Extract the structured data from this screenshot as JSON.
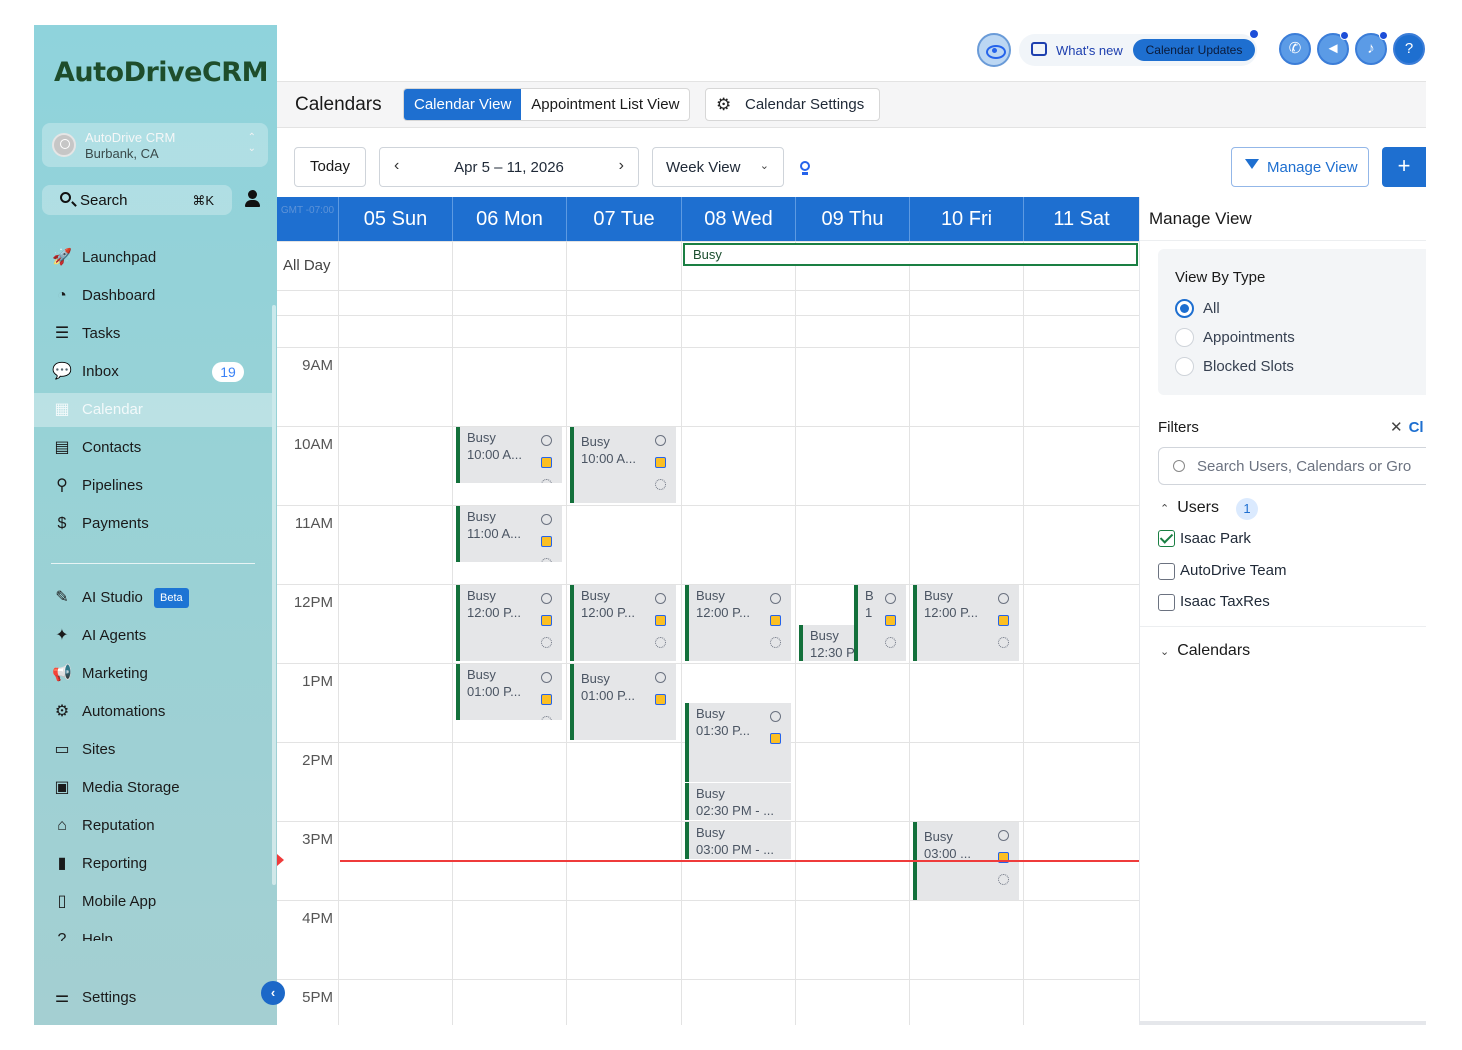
{
  "app": {
    "brand": "AutoDriveCRM",
    "account": {
      "name": "AutoDrive CRM",
      "location": "Burbank, CA"
    },
    "search": {
      "label": "Search",
      "shortcut": "⌘K"
    }
  },
  "sidebar": {
    "items": [
      {
        "label": "Launchpad",
        "icon": "rocket-icon",
        "glyph": "🚀"
      },
      {
        "label": "Dashboard",
        "icon": "gauge-icon",
        "glyph": "◔"
      },
      {
        "label": "Tasks",
        "icon": "checklist-icon",
        "glyph": "☰"
      },
      {
        "label": "Inbox",
        "icon": "chat-icon",
        "glyph": "💬",
        "badge": "19"
      },
      {
        "label": "Calendar",
        "icon": "calendar-icon",
        "glyph": "▦",
        "active": true
      },
      {
        "label": "Contacts",
        "icon": "contact-card-icon",
        "glyph": "▤"
      },
      {
        "label": "Pipelines",
        "icon": "pipeline-icon",
        "glyph": "⚲"
      },
      {
        "label": "Payments",
        "icon": "payments-icon",
        "glyph": "$"
      }
    ],
    "items2": [
      {
        "label": "AI Studio",
        "icon": "ai-studio-icon",
        "glyph": "✎",
        "badge": "Beta"
      },
      {
        "label": "AI Agents",
        "icon": "sparkles-icon",
        "glyph": "✦"
      },
      {
        "label": "Marketing",
        "icon": "megaphone-icon",
        "glyph": "📢"
      },
      {
        "label": "Automations",
        "icon": "gear-cog-icon",
        "glyph": "⚙"
      },
      {
        "label": "Sites",
        "icon": "browser-icon",
        "glyph": "▭"
      },
      {
        "label": "Media Storage",
        "icon": "image-icon",
        "glyph": "▣"
      },
      {
        "label": "Reputation",
        "icon": "storefront-icon",
        "glyph": "⌂"
      },
      {
        "label": "Reporting",
        "icon": "bar-chart-icon",
        "glyph": "▮"
      },
      {
        "label": "Mobile App",
        "icon": "phone-icon",
        "glyph": "▯"
      },
      {
        "label": "Help",
        "icon": "help-icon",
        "glyph": "?"
      }
    ],
    "settings": {
      "label": "Settings",
      "icon": "toggles-icon",
      "glyph": "⚌"
    }
  },
  "topbar": {
    "whats_new": "What's new",
    "calendar_updates": "Calendar Updates",
    "help": "?"
  },
  "header": {
    "title": "Calendars",
    "tabs": [
      "Calendar View",
      "Appointment List View"
    ],
    "settings_tab": "Calendar Settings"
  },
  "toolbar": {
    "today": "Today",
    "date_range": "Apr 5 – 11, 2026",
    "view_select": "Week View",
    "manage_view": "Manage View",
    "add": "+"
  },
  "calendar": {
    "timezone": "GMT -07:00",
    "days": [
      "05 Sun",
      "06 Mon",
      "07 Tue",
      "08 Wed",
      "09 Thu",
      "10 Fri",
      "11 Sat"
    ],
    "all_day_label": "All Day",
    "all_day_event": "Busy",
    "hours": [
      "9AM",
      "10AM",
      "11AM",
      "12PM",
      "1PM",
      "2PM",
      "3PM",
      "4PM",
      "5PM"
    ],
    "events": [
      {
        "title": "Busy",
        "time": "10:00 A..."
      },
      {
        "title": "Busy",
        "time": "10:00 A..."
      },
      {
        "title": "Busy",
        "time": "11:00 A..."
      },
      {
        "title": "Busy",
        "time": "12:00 P..."
      },
      {
        "title": "Busy",
        "time": "12:00 P..."
      },
      {
        "title": "Busy",
        "time": "12:00 P..."
      },
      {
        "title": "Busy",
        "time": "12:30 P"
      },
      {
        "title": "B",
        "time": "1"
      },
      {
        "title": "Busy",
        "time": "12:00 P..."
      },
      {
        "title": "Busy",
        "time": "01:00 P..."
      },
      {
        "title": "Busy",
        "time": "01:00 P..."
      },
      {
        "title": "Busy",
        "time": "01:30 P..."
      },
      {
        "title": "Busy",
        "time": "02:30 PM - ..."
      },
      {
        "title": "Busy",
        "time": "03:00 PM - ..."
      },
      {
        "title": "Busy",
        "time": "03:00 ..."
      }
    ]
  },
  "panel": {
    "title": "Manage View",
    "view_by_type": "View By Type",
    "types": [
      "All",
      "Appointments",
      "Blocked Slots"
    ],
    "selected_type": "All",
    "filters_label": "Filters",
    "clear_label": "Cl",
    "search_placeholder": "Search Users, Calendars or Gro",
    "users_label": "Users",
    "users_count": "1",
    "users": [
      {
        "name": "Isaac Park",
        "checked": true
      },
      {
        "name": "AutoDrive Team",
        "checked": false
      },
      {
        "name": "Isaac TaxRes",
        "checked": false
      }
    ],
    "calendars_label": "Calendars"
  },
  "colors": {
    "accent": "#1e6fd0",
    "event_border": "#13703b",
    "now_line": "#ef3b3b",
    "sidebar_top": "#8fd3dc"
  }
}
